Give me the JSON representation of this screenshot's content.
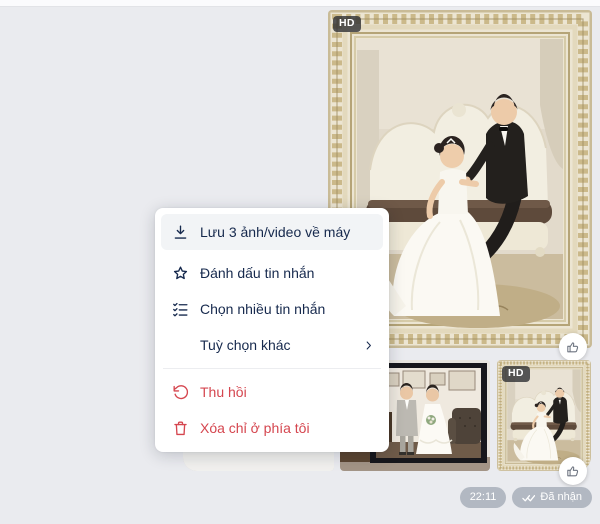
{
  "chat": {
    "large_photo": {
      "hd_badge": "HD"
    },
    "thumbnails": [
      {
        "desc": "light table surface"
      },
      {
        "desc": "framed standing couple photo"
      },
      {
        "desc": "framed wedding couple photo",
        "hd_badge": "HD"
      }
    ],
    "status": {
      "time": "22:11",
      "receipt": "Đã nhận"
    }
  },
  "context_menu": {
    "items": [
      {
        "label": "Lưu 3 ảnh/video về máy",
        "icon": "download-icon",
        "state": "hover"
      },
      {
        "label": "Đánh dấu tin nhắn",
        "icon": "star-icon"
      },
      {
        "label": "Chọn nhiều tin nhắn",
        "icon": "checklist-icon"
      },
      {
        "label": "Tuỳ chọn khác",
        "icon": "none",
        "trailing_icon": "chevron-right-icon"
      },
      {
        "label": "Thu hồi",
        "icon": "undo-icon",
        "danger": true
      },
      {
        "label": "Xóa chỉ ở phía tôi",
        "icon": "trash-icon",
        "danger": true
      }
    ]
  },
  "colors": {
    "background": "#eaebef",
    "menu_text": "#16294d",
    "danger": "#d5464f",
    "pill_bg": "#b2b8c2",
    "hover_highlight": "#f2f4f6"
  }
}
